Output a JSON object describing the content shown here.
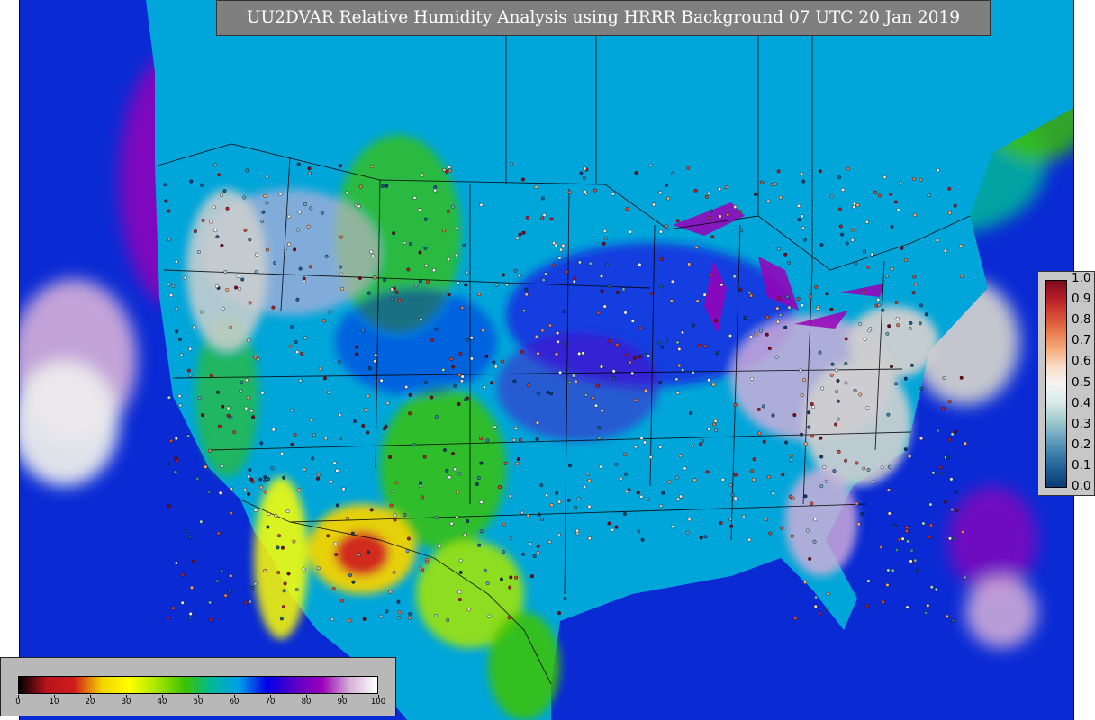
{
  "title": "UU2DVAR Relative Humidity Analysis using HRRR Background 07 UTC 20 Jan 2019",
  "legend_rh": {
    "min": 0,
    "max": 100,
    "tick_labels": [
      "0",
      "10",
      "20",
      "30",
      "40",
      "50",
      "60",
      "70",
      "80",
      "90",
      "100"
    ],
    "colors": [
      "#000000",
      "#b8131c",
      "#d01c1c",
      "#f2d300",
      "#ffff00",
      "#a6e600",
      "#3cc300",
      "#00b89a",
      "#009de8",
      "#0000e6",
      "#5800c8",
      "#9b00b8",
      "#d7b0d8",
      "#ffffff"
    ]
  },
  "legend_obs": {
    "min": 0.0,
    "max": 1.0,
    "tick_labels": [
      "1.0",
      "0.9",
      "0.8",
      "0.7",
      "0.6",
      "0.5",
      "0.4",
      "0.3",
      "0.2",
      "0.1",
      "0.0"
    ],
    "colors": [
      "#0b3d70",
      "#1d5d95",
      "#3e82ad",
      "#72a9c2",
      "#a9cfd0",
      "#dcecea",
      "#f4f4f4",
      "#f9dcc8",
      "#f4ad7c",
      "#e87b4d",
      "#d34a35",
      "#b61d27",
      "#7d0a1a"
    ]
  },
  "map": {
    "ocean_color": "#0a2bd4",
    "land_color": "#00a6d9",
    "dry_color": "#00c020",
    "very_dry_color": "#cc1020",
    "saturated_color": "#cfcfcf"
  }
}
